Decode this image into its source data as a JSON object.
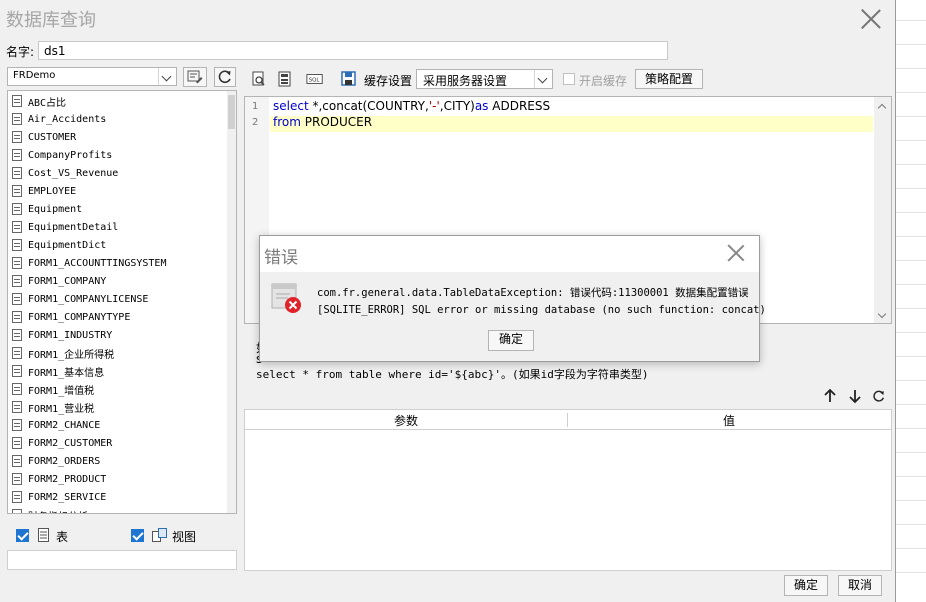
{
  "window": {
    "title": "数据库查询"
  },
  "name_field": {
    "label": "名字:",
    "value": "ds1"
  },
  "connection": {
    "selected": "FRDemo"
  },
  "tables": [
    "ABC占比",
    "Air_Accidents",
    "CUSTOMER",
    "CompanyProfits",
    "Cost_VS_Revenue",
    "EMPLOYEE",
    "Equipment",
    "EquipmentDetail",
    "EquipmentDict",
    "FORM1_ACCOUNTTINGSYSTEM",
    "FORM1_COMPANY",
    "FORM1_COMPANYLICENSE",
    "FORM1_COMPANYTYPE",
    "FORM1_INDUSTRY",
    "FORM1_企业所得税",
    "FORM1_基本信息",
    "FORM1_增值税",
    "FORM1_营业税",
    "FORM2_CHANCE",
    "FORM2_CUSTOMER",
    "FORM2_ORDERS",
    "FORM2_PRODUCT",
    "FORM2_SERVICE",
    "财务指标分析"
  ],
  "filters": {
    "tables_label": "表",
    "views_label": "视图"
  },
  "toolbar": {
    "cache_label": "缓存设置",
    "cache_option": "采用服务器设置",
    "enable_cache_label": "开启缓存",
    "strategy_button": "策略配置"
  },
  "sql": {
    "line_numbers": [
      "1",
      "2"
    ],
    "line1": {
      "kw1": "select",
      "t1": " *,",
      "fn": "concat",
      "t2": "(COUNTRY,",
      "str": "'-'",
      "t3": ",CITY)",
      "kw2": "as",
      "t4": " ADDRESS"
    },
    "line2": {
      "kw": "from",
      "t": " PRODUCER"
    }
  },
  "hints": {
    "line1": "如",
    "line2": "s",
    "line3": "select * from table where id='${abc}'。(如果id字段为字符串类型)"
  },
  "params_table": {
    "col_param": "参数",
    "col_value": "值"
  },
  "buttons": {
    "ok": "确定",
    "cancel": "取消"
  },
  "error_dialog": {
    "title": "错误",
    "line1": "com.fr.general.data.TableDataException: 错误代码:11300001 数据集配置错误",
    "line2": "[SQLITE_ERROR] SQL error or missing database (no such function: concat)",
    "ok": "确定"
  }
}
